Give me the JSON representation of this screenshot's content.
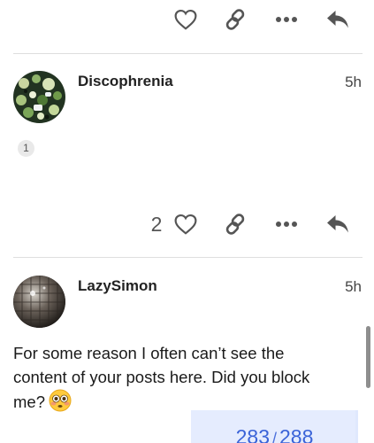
{
  "colors": {
    "icon": "#555555",
    "divider": "#dedede",
    "progress_bg": "#dfe8fd",
    "progress_text": "#3a63d8"
  },
  "top_actions": {
    "icons": [
      "heart-icon",
      "link-icon",
      "ellipsis-icon",
      "reply-icon"
    ]
  },
  "posts": [
    {
      "username": "Discophrenia",
      "time": "5h",
      "quote_count": "1",
      "like_count": "2",
      "actions": [
        "heart-icon",
        "link-icon",
        "ellipsis-icon",
        "reply-icon"
      ]
    },
    {
      "username": "LazySimon",
      "time": "5h",
      "body": "For some reason I often can’t see the content of your posts here. Did you block me?",
      "emoji": "flushed-face-emoji"
    }
  ],
  "progress": {
    "current": "283",
    "separator": "/",
    "total": "288",
    "fraction": 0.983
  }
}
